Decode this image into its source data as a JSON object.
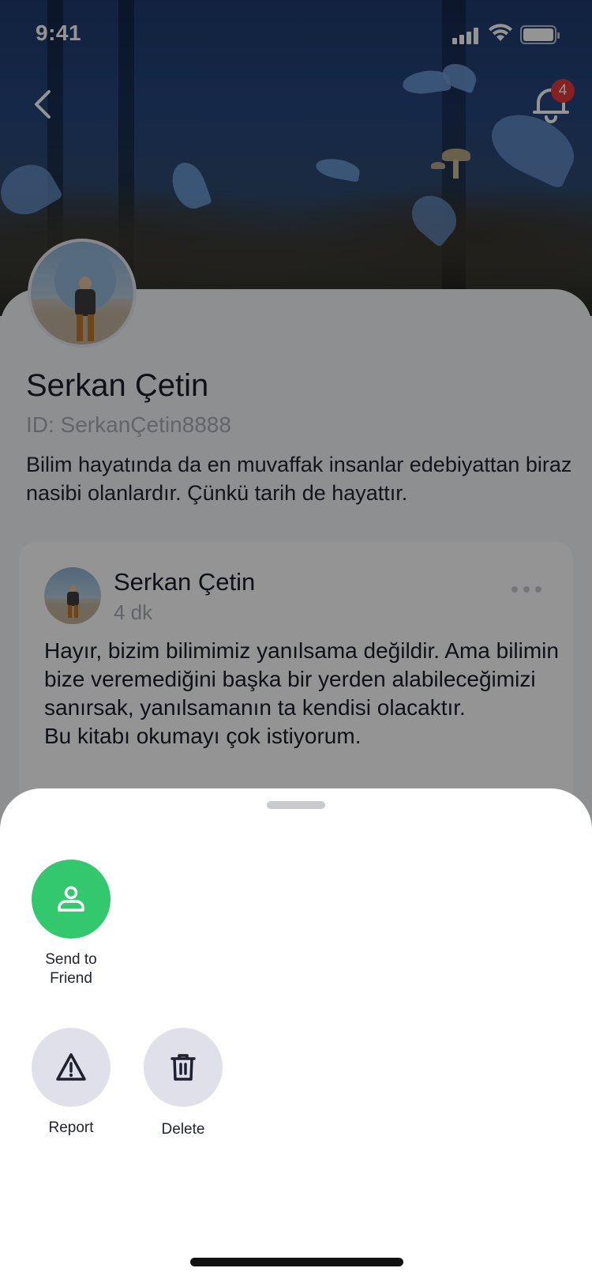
{
  "status_bar": {
    "time": "9:41"
  },
  "header": {
    "notification_count": "4"
  },
  "profile": {
    "name": "Serkan Çetin",
    "id_text": "ID: SerkanÇetin8888",
    "bio": "Bilim hayatında da en muvaffak insanlar edebiyattan biraz nasibi olanlardır. Çünkü tarih de hayattır."
  },
  "post": {
    "author": "Serkan Çetin",
    "time": "4 dk",
    "text": "Hayır, bizim bilimimiz yanılsama değildir. Ama bilimin bize veremediğini başka bir yerden alabileceğimizi sanırsak, yanılsamanın ta kendisi olacaktır.\nBu kitabı okumayı çok istiyorum."
  },
  "sheet": {
    "actions": [
      {
        "label": "Send to\nFriend",
        "icon": "person-icon",
        "color": "#33c76e"
      },
      {
        "label": "Report",
        "icon": "warning-icon",
        "color": "#dfe0ea"
      },
      {
        "label": "Delete",
        "icon": "trash-icon",
        "color": "#dfe0ea"
      }
    ]
  },
  "colors": {
    "accent_green": "#33c76e",
    "badge_red": "#e5393a"
  }
}
